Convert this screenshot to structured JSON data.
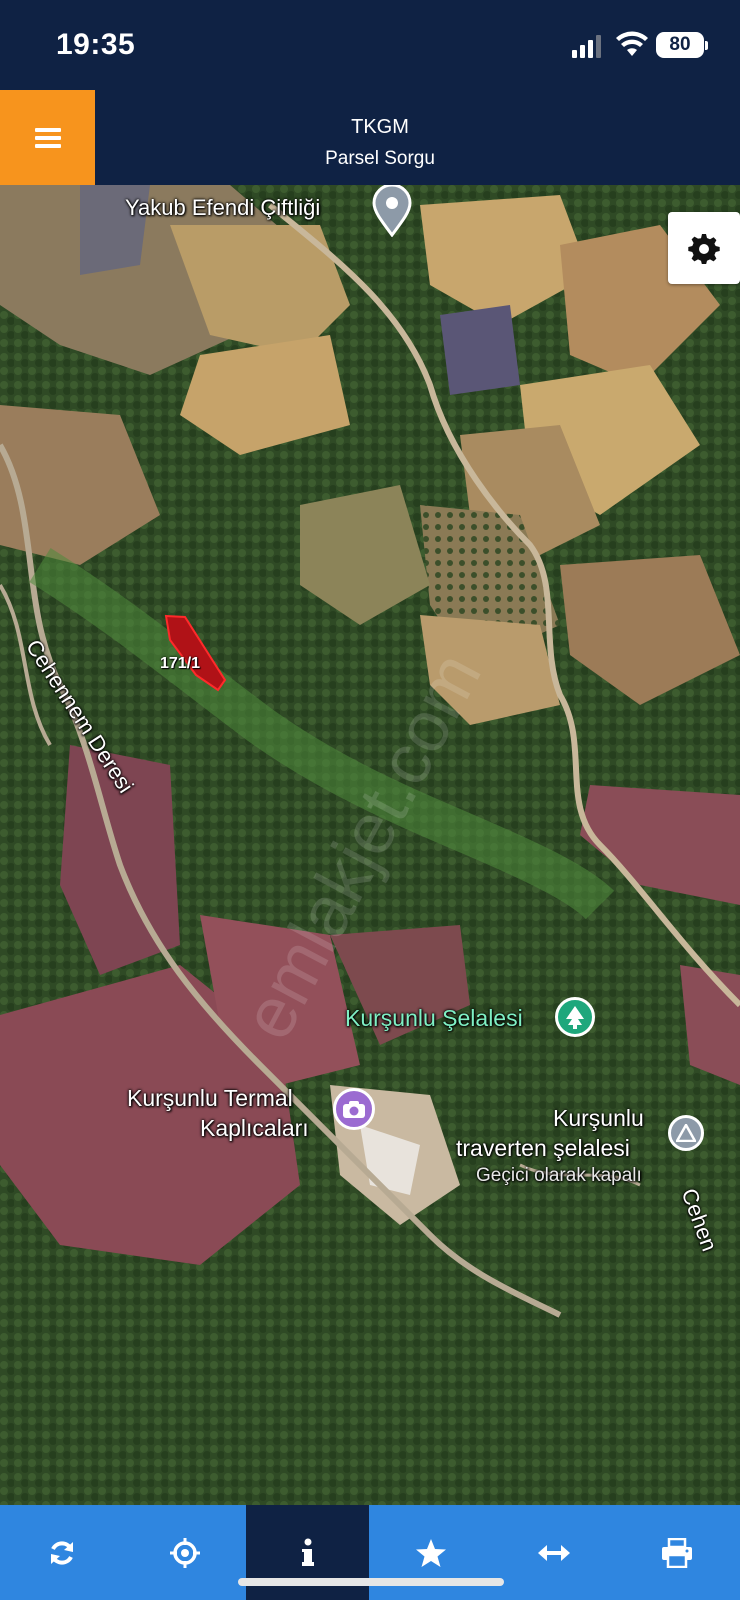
{
  "status": {
    "time": "19:35",
    "battery": "80"
  },
  "header": {
    "title": "TKGM",
    "subtitle": "Parsel Sorgu",
    "accent_color": "#f7941d"
  },
  "map": {
    "labels": {
      "farm": "Yakub Efendi Çiftliği",
      "creek": "Cehennem Deresi",
      "parcel": "171/1",
      "waterfall": "Kurşunlu Şelalesi",
      "spa_line1": "Kurşunlu Termal",
      "spa_line2": "Kaplıcaları",
      "travertine_line1": "Kurşunlu",
      "travertine_line2": "traverten şelalesi",
      "travertine_status": "Geçici olarak kapalı",
      "creek_edge": "Cehen",
      "watermark": "emlakjet.com"
    }
  },
  "toolbar": {
    "items": [
      {
        "name": "refresh-icon"
      },
      {
        "name": "locate-icon"
      },
      {
        "name": "info-icon",
        "active": true
      },
      {
        "name": "star-icon"
      },
      {
        "name": "measure-icon"
      },
      {
        "name": "print-icon"
      }
    ],
    "bg_color": "#2f86e0",
    "active_color": "#0f2244"
  }
}
